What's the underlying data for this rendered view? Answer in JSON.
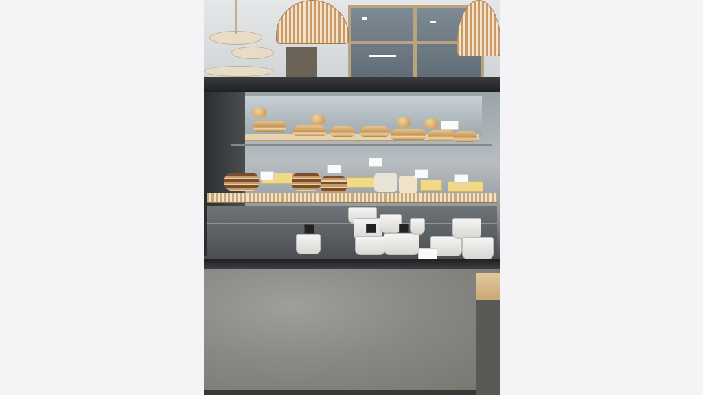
{
  "scene": {
    "subject": "bakery-display-case",
    "colors": {
      "page_background": "#f4f4f6",
      "counter_concrete": "#8c8a86",
      "wood": "#d8b98c",
      "glass": "#c9d3d8",
      "interior_dark": "#2d2f31"
    },
    "icons": [
      "pendant-lamp-icon",
      "price-tag-icon"
    ]
  }
}
